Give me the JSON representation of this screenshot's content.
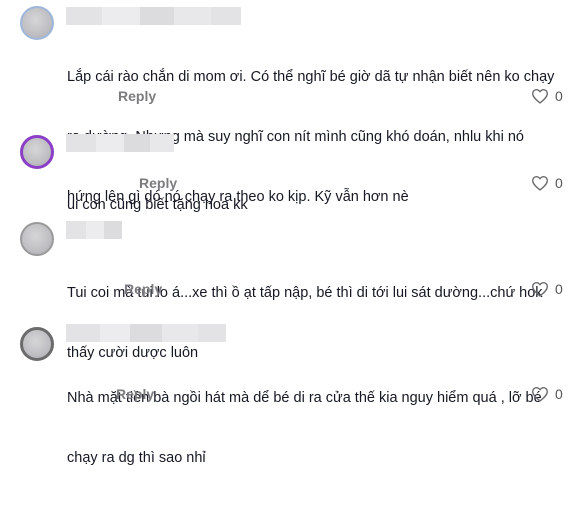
{
  "comments": [
    {
      "text_lines": [
        "Lắp cái rào chắn di mom ơi. Có thể nghĩ bé giờ dã tự nhận biết nên ko chạy",
        "ra dường. Nhưng mà suy nghĩ con nít mình cũng khó doán, nhlu khi nó",
        "hứng lên gì dó nó chạy ra theo ko kịp. Kỹ vẫn hơn nè"
      ],
      "reply_label": "Reply",
      "like_count": "0",
      "icon": "heart-outline"
    },
    {
      "text_lines": [
        "ui con cũng biết tặng hoa kk"
      ],
      "reply_label": "Reply",
      "like_count": "0",
      "icon": "heart-outline"
    },
    {
      "text_lines": [
        "Tui coi mà tui lo á...xe thì ồ ạt tấp nập, bé thì di tới lui sát dường...chứ hok",
        "thấy cười dược luôn"
      ],
      "reply_label": "Reply",
      "like_count": "0",
      "icon": "heart-outline"
    },
    {
      "text_lines": [
        "Nhà mặt tiền bà ngồi hát mà dể bé di ra cửa thế kia nguy hiểm quá , lỡ bé",
        "chạy ra dg thì sao nhỉ"
      ],
      "reply_label": "Reply",
      "like_count": "0",
      "icon": "heart-outline"
    }
  ],
  "colors": {
    "text": "#161823",
    "reply": "#7b7b80",
    "background": "#ffffff"
  }
}
